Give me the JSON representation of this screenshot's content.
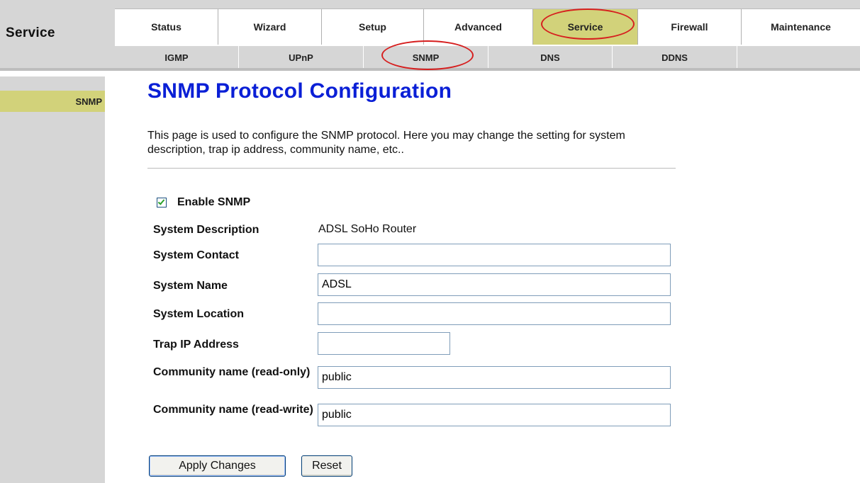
{
  "header": {
    "section_title": "Service",
    "main_tabs": [
      {
        "label": "Status",
        "active": false
      },
      {
        "label": "Wizard",
        "active": false
      },
      {
        "label": "Setup",
        "active": false
      },
      {
        "label": "Advanced",
        "active": false
      },
      {
        "label": "Service",
        "active": true
      },
      {
        "label": "Firewall",
        "active": false
      },
      {
        "label": "Maintenance",
        "active": false
      }
    ],
    "sub_tabs": [
      {
        "label": "IGMP"
      },
      {
        "label": "UPnP"
      },
      {
        "label": "SNMP",
        "active": true
      },
      {
        "label": "DNS"
      },
      {
        "label": "DDNS"
      },
      {
        "label": ""
      }
    ]
  },
  "sidebar": {
    "items": [
      {
        "label": "SNMP",
        "active": true
      }
    ]
  },
  "main": {
    "title": "SNMP Protocol Configuration",
    "description": "This page is used to configure the SNMP protocol. Here you may change the setting for system description, trap ip address, community name, etc..",
    "enable": {
      "label": "Enable SNMP",
      "checked": true
    },
    "fields": {
      "system_description": {
        "label": "System Description",
        "value": "ADSL SoHo Router"
      },
      "system_contact": {
        "label": "System Contact",
        "value": ""
      },
      "system_name": {
        "label": "System Name",
        "value": "ADSL"
      },
      "system_location": {
        "label": "System Location",
        "value": ""
      },
      "trap_ip": {
        "label": "Trap IP Address",
        "value": ""
      },
      "community_ro": {
        "label": "Community name (read-only)",
        "value": "public"
      },
      "community_rw": {
        "label": "Community name (read-write)",
        "value": "public"
      }
    },
    "buttons": {
      "apply": "Apply Changes",
      "reset": "Reset"
    }
  },
  "colors": {
    "active_tab": "#d2d27a",
    "title_blue": "#0a1fd6",
    "highlight_circle": "#d61f1f",
    "chrome_gray": "#d6d6d6"
  }
}
